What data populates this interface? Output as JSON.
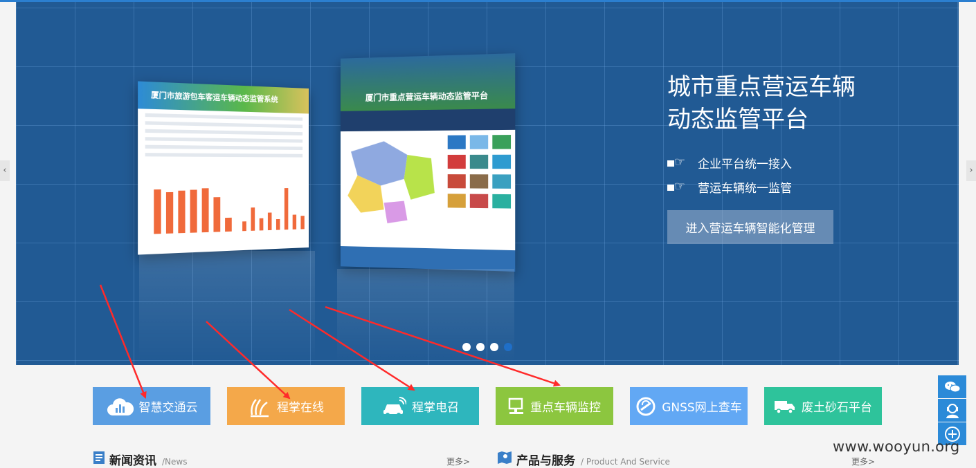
{
  "banner": {
    "title_line1": "城市重点营运车辆",
    "title_line2": "动态监管平台",
    "bullets": [
      "企业平台统一接入",
      "营运车辆统一监管"
    ],
    "enter_button": "进入营运车辆智能化管理",
    "screenshot_left_title": "厦门市旅游包车客运车辆动态监管系统",
    "screenshot_right_title": "厦门市重点营运车辆动态监管平台",
    "slides_total": 4,
    "slide_active": 4
  },
  "services": [
    {
      "label": "智慧交通云",
      "icon": "cloud-chart-icon",
      "color": "#5a9ee2"
    },
    {
      "label": "程掌在线",
      "icon": "hand-wave-icon",
      "color": "#f4a84a"
    },
    {
      "label": "程掌电召",
      "icon": "taxi-signal-icon",
      "color": "#2eb6bd"
    },
    {
      "label": "重点车辆监控",
      "icon": "monitor-icon",
      "color": "#8cc63f"
    },
    {
      "label": "GNSS网上查车",
      "icon": "gnss-icon",
      "color": "#62a8f4"
    },
    {
      "label": "废土砂石平台",
      "icon": "truck-icon",
      "color": "#2ec39b"
    }
  ],
  "sections": {
    "news": {
      "title": "新闻资讯",
      "subtitle": "/News",
      "more": "更多>"
    },
    "products": {
      "title": "产品与服务",
      "subtitle": "/ Product And Service",
      "more": "更多>"
    }
  },
  "floating": [
    "wechat-icon",
    "customer-service-icon",
    "plus-icon"
  ],
  "watermark": "www.wooyun.org",
  "colors": {
    "banner": "#215a94",
    "accent": "#2b8ad8",
    "arrow": "#ff2a2a"
  }
}
